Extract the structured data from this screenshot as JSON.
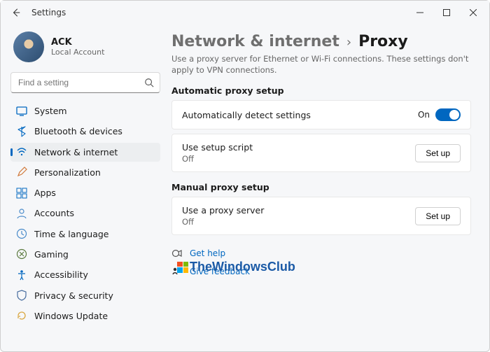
{
  "window": {
    "title": "Settings"
  },
  "profile": {
    "name": "ACK",
    "subtitle": "Local Account"
  },
  "search": {
    "placeholder": "Find a setting"
  },
  "sidebar": {
    "items": [
      {
        "id": "system",
        "label": "System",
        "color": "#0067c0"
      },
      {
        "id": "bluetooth",
        "label": "Bluetooth & devices",
        "color": "#0067c0"
      },
      {
        "id": "network",
        "label": "Network & internet",
        "color": "#0067c0",
        "active": true
      },
      {
        "id": "personalization",
        "label": "Personalization",
        "color": "#d17a3b"
      },
      {
        "id": "apps",
        "label": "Apps",
        "color": "#0067c0"
      },
      {
        "id": "accounts",
        "label": "Accounts",
        "color": "#4a8bca"
      },
      {
        "id": "time",
        "label": "Time & language",
        "color": "#4a8bca"
      },
      {
        "id": "gaming",
        "label": "Gaming",
        "color": "#5b7a3f"
      },
      {
        "id": "accessibility",
        "label": "Accessibility",
        "color": "#0067c0"
      },
      {
        "id": "privacy",
        "label": "Privacy & security",
        "color": "#4a6fa0"
      },
      {
        "id": "update",
        "label": "Windows Update",
        "color": "#d9a63f"
      }
    ]
  },
  "page": {
    "breadcrumb_parent": "Network & internet",
    "breadcrumb_current": "Proxy",
    "description": "Use a proxy server for Ethernet or Wi-Fi connections. These settings don't apply to VPN connections.",
    "automatic_section_label": "Automatic proxy setup",
    "auto_detect": {
      "label": "Automatically detect settings",
      "state_text": "On",
      "state": true
    },
    "setup_script": {
      "label": "Use setup script",
      "state_text": "Off",
      "button": "Set up"
    },
    "manual_section_label": "Manual proxy setup",
    "manual_proxy": {
      "label": "Use a proxy server",
      "state_text": "Off",
      "button": "Set up"
    },
    "help_link": "Get help",
    "feedback_link": "Give feedback",
    "watermark": "TheWindowsClub"
  }
}
